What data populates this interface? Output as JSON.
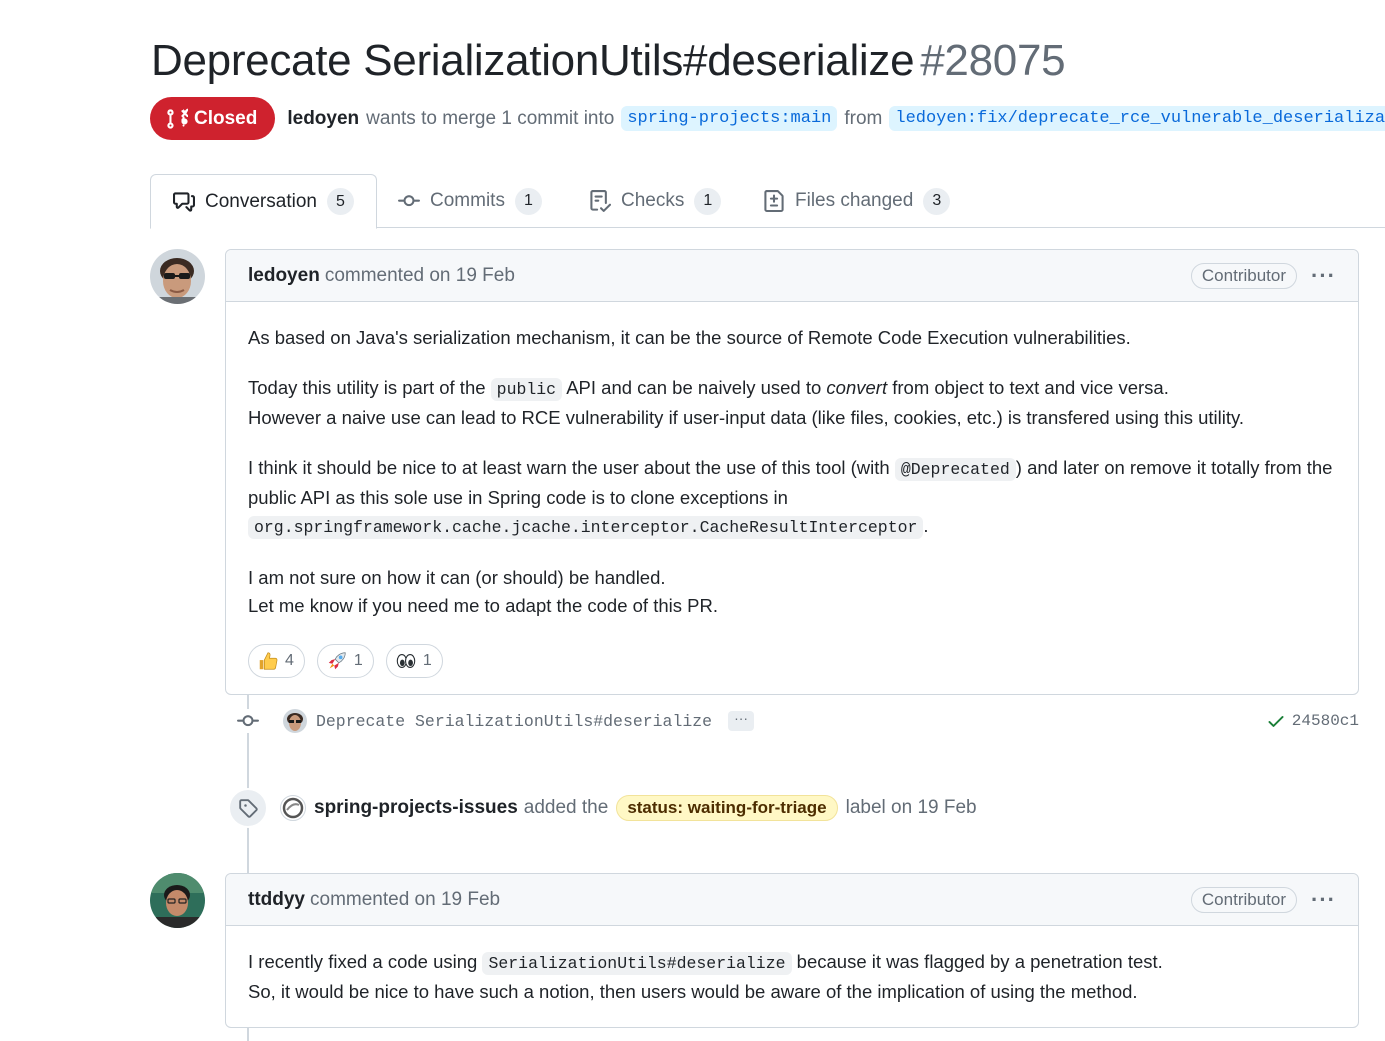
{
  "pr": {
    "title": "Deprecate SerializationUtils#deserialize",
    "number": "#28075",
    "state": "Closed",
    "author": "ledoyen",
    "merge_text": "wants to merge 1 commit into",
    "base_branch": "spring-projects:main",
    "from_text": "from",
    "head_branch": "ledoyen:fix/deprecate_rce_vulnerable_deserialization",
    "state_color": "#cf222e"
  },
  "tabs": [
    {
      "label": "Conversation",
      "count": "5",
      "icon": "comment-discussion-icon"
    },
    {
      "label": "Commits",
      "count": "1",
      "icon": "git-commit-icon"
    },
    {
      "label": "Checks",
      "count": "1",
      "icon": "checklist-icon"
    },
    {
      "label": "Files changed",
      "count": "3",
      "icon": "file-diff-icon"
    }
  ],
  "comment1": {
    "author": "ledoyen",
    "meta": "commented on 19 Feb",
    "role": "Contributor",
    "menu": "···",
    "p1": "As based on Java's serialization mechanism, it can be the source of Remote Code Execution vulnerabilities.",
    "p2_a": "Today this utility is part of the",
    "p2_code": "public",
    "p2_b": "API and can be naively used to",
    "p2_em": "convert",
    "p2_c": "from object to text and vice versa.",
    "p2_line2": "However a naive use can lead to RCE vulnerability if user-input data (like files, cookies, etc.) is transfered using this utility.",
    "p3_a": "I think it should be nice to at least warn the user about the use of this tool (with",
    "p3_code1": "@Deprecated",
    "p3_b": ") and later on remove it totally from the public API as this sole use in Spring code is to clone exceptions in",
    "p3_code2": "org.springframework.cache.jcache.interceptor.CacheResultInterceptor",
    "p3_c": ".",
    "p4_line1": "I am not sure on how it can (or should) be handled.",
    "p4_line2": "Let me know if you need me to adapt the code of this PR.",
    "reactions": [
      {
        "emoji": "thumbs-up",
        "count": "4"
      },
      {
        "emoji": "rocket",
        "count": "1"
      },
      {
        "emoji": "eyes",
        "count": "1"
      }
    ]
  },
  "commit": {
    "message": "Deprecate SerializationUtils#deserialize",
    "more": "···",
    "sha": "24580c1"
  },
  "label_event": {
    "actor": "spring-projects-issues",
    "action": "added the",
    "label": "status: waiting-for-triage",
    "suffix": "label on 19 Feb"
  },
  "comment2": {
    "author": "ttddyy",
    "meta": "commented on 19 Feb",
    "role": "Contributor",
    "menu": "···",
    "p1_a": "I recently fixed a code using",
    "p1_code": "SerializationUtils#deserialize",
    "p1_b": "because it was flagged by a penetration test.",
    "p1_line2": "So, it would be nice to have such a notion, then users would be aware of the implication of using the method."
  }
}
